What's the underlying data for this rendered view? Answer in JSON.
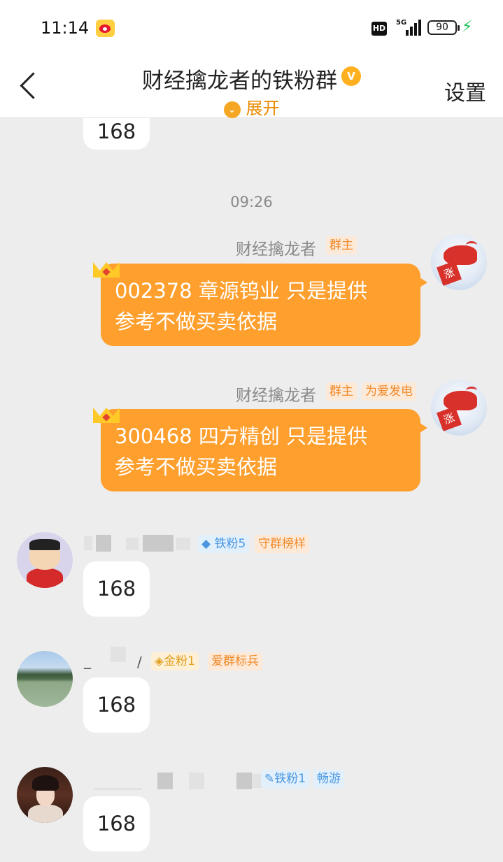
{
  "status_bar": {
    "time": "11:14",
    "hd": "HD",
    "network": "5G",
    "battery": "90"
  },
  "header": {
    "title": "财经擒龙者的铁粉群",
    "verified_badge": "V",
    "expand_label": "展开",
    "settings_label": "设置"
  },
  "messages": {
    "top_partial": {
      "text": "168"
    },
    "timestamp": "09:26",
    "owner_msg_1": {
      "sender": "财经擒龙者",
      "tags": [
        "群主"
      ],
      "text_line1": "002378 章源钨业  只是提供",
      "text_line2": "参考不做买卖依据",
      "avatar_sign": "涨"
    },
    "owner_msg_2": {
      "sender": "财经擒龙者",
      "tags": [
        "群主",
        "为爱发电"
      ],
      "text_line1": "300468 四方精创  只是提供",
      "text_line2": "参考不做买卖依据",
      "avatar_sign": "涨"
    },
    "member_msg_1": {
      "tags": [
        "铁粉5",
        "守群榜样"
      ],
      "text": "168"
    },
    "member_msg_2": {
      "tags": [
        "金粉1",
        "爱群标兵"
      ],
      "text": "168"
    },
    "member_msg_3": {
      "tags": [
        "铁粉1",
        "畅游"
      ],
      "text": "168"
    }
  },
  "colors": {
    "accent_orange": "#ff9f2d",
    "tag_orange": "#ef8a2a",
    "tag_blue": "#4a97e0",
    "background": "#ededed"
  },
  "icons": {
    "back": "chevron-left-icon",
    "expand": "chevron-down-circle-icon",
    "crown": "crown-icon",
    "charging": "bolt-icon"
  }
}
